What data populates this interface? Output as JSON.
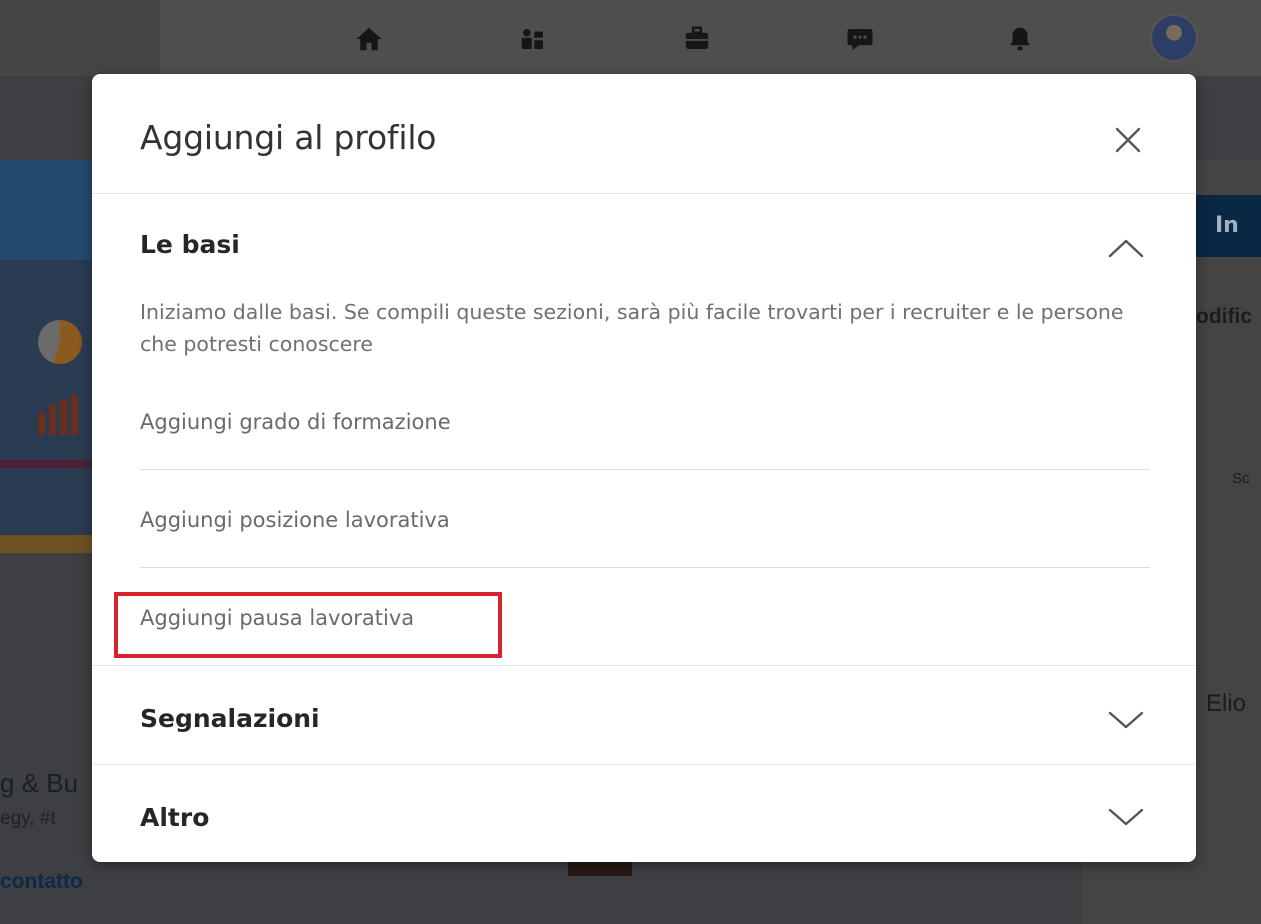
{
  "modal": {
    "title": "Aggiungi al profilo",
    "close_icon": "close-icon",
    "sections": [
      {
        "title": "Le basi",
        "state": "expanded",
        "chevron_icon": "chevron-up-icon",
        "description": "Iniziamo dalle basi. Se compili queste sezioni, sarà più facile trovarti per i recruiter e le persone che potresti conoscere",
        "items": [
          {
            "label": "Aggiungi grado di formazione"
          },
          {
            "label": "Aggiungi posizione lavorativa"
          },
          {
            "label": "Aggiungi pausa lavorativa",
            "highlighted": true
          }
        ]
      },
      {
        "title": "Segnalazioni",
        "state": "collapsed",
        "chevron_icon": "chevron-down-icon"
      },
      {
        "title": "Altro",
        "state": "collapsed",
        "chevron_icon": "chevron-down-icon"
      }
    ]
  },
  "background": {
    "nav_icons": [
      "home-icon",
      "network-icon",
      "jobs-icon",
      "messaging-icon",
      "notifications-icon"
    ],
    "right_button_partial": "In",
    "right_edit_partial": "odific",
    "right_small_partial": "Sc",
    "right_name_partial": "Elio",
    "left_headline_partial": "g & Bu",
    "left_tags_partial": "egy, #t",
    "left_link_partial": "contatto"
  },
  "colors": {
    "highlight_border": "#d6232e",
    "modal_bg": "#ffffff",
    "overlay": "#3d3f42"
  }
}
